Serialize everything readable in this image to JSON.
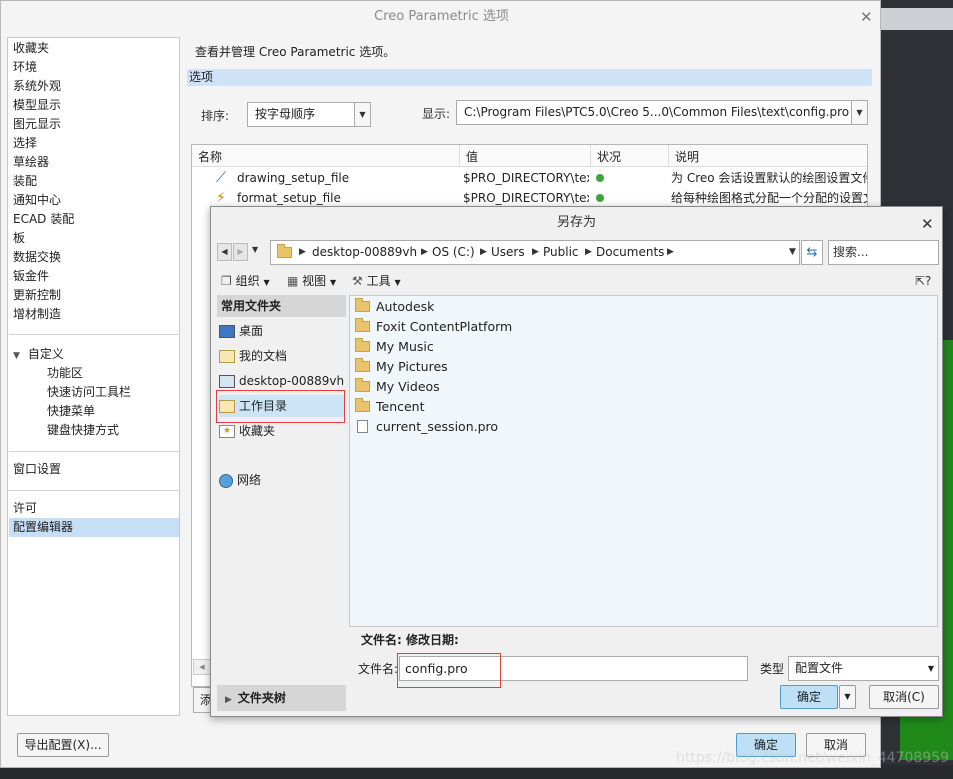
{
  "main_dialog": {
    "title": "Creo Parametric 选项",
    "description": "查看并管理 Creo Parametric 选项。",
    "options_header": "选项",
    "sort_label": "排序:",
    "sort_value": "按字母顺序",
    "display_label": "显示:",
    "display_value": "C:\\Program Files\\PTC5.0\\Creo 5...0\\Common Files\\text\\config.pro",
    "export_button": "导出配置(X)...",
    "ok_button": "确定",
    "cancel_button": "取消",
    "add_stub": "添"
  },
  "nav": {
    "items": [
      "收藏夹",
      "环境",
      "系统外观",
      "模型显示",
      "图元显示",
      "选择",
      "草绘器",
      "装配",
      "通知中心",
      "ECAD 装配",
      "板",
      "数据交换",
      "钣金件",
      "更新控制",
      "增材制造"
    ],
    "customize_label": "自定义",
    "customize_items": [
      "功能区",
      "快速访问工具栏",
      "快捷菜单",
      "键盘快捷方式"
    ],
    "window_settings": "窗口设置",
    "license": "许可",
    "config_editor": "配置编辑器"
  },
  "table": {
    "headers": [
      "名称",
      "值",
      "状况",
      "说明"
    ],
    "rows": [
      {
        "name": "drawing_setup_file",
        "value": "$PRO_DIRECTORY\\tex",
        "desc": "为 Creo 会话设置默认的绘图设置文件"
      },
      {
        "name": "format_setup_file",
        "value": "$PRO_DIRECTORY\\tex",
        "desc": "给每种绘图格式分配一个分配的设置文件"
      }
    ]
  },
  "save_as": {
    "title": "另存为",
    "breadcrumbs": [
      "desktop-00889vh",
      "OS (C:)",
      "Users",
      "Public",
      "Documents"
    ],
    "search_placeholder": "搜索...",
    "toolbar": {
      "organize": "组织",
      "view": "视图",
      "tools": "工具"
    },
    "places_header": "常用文件夹",
    "places": [
      "桌面",
      "我的文档",
      "desktop-00889vh",
      "工作目录",
      "收藏夹"
    ],
    "network": "网络",
    "folder_tree": "文件夹树",
    "folders": [
      "Autodesk",
      "Foxit ContentPlatform",
      "My Music",
      "My Pictures",
      "My Videos",
      "Tencent"
    ],
    "files": [
      "current_session.pro"
    ],
    "meta_label": "文件名:  修改日期:",
    "filename_label": "文件名:",
    "filename_value": "config.pro",
    "type_label": "类型",
    "type_value": "配置文件",
    "ok_button": "确定",
    "cancel_button": "取消(C)"
  },
  "watermark": "https://blog.csdn.net/weixin_44708959"
}
